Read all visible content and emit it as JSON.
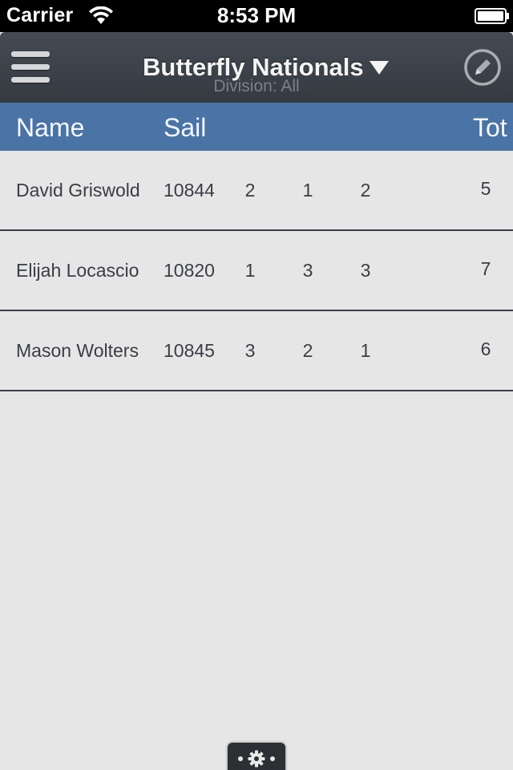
{
  "status_bar": {
    "carrier": "Carrier",
    "time": "8:53 PM"
  },
  "nav": {
    "title": "Butterfly Nationals",
    "subtitle": "Division: All",
    "menu_icon": "hamburger-menu-icon",
    "dropdown_icon": "triangle-down-icon",
    "edit_icon": "pencil-circle-icon"
  },
  "table": {
    "headers": {
      "name": "Name",
      "sail": "Sail",
      "total": "Tot"
    },
    "rows": [
      {
        "name": "David Griswold",
        "sail": "10844",
        "r1": "2",
        "r2": "1",
        "r3": "2",
        "total": "5"
      },
      {
        "name": "Elijah Locascio",
        "sail": "10820",
        "r1": "1",
        "r2": "3",
        "r3": "3",
        "total": "7"
      },
      {
        "name": "Mason Wolters",
        "sail": "10845",
        "r1": "3",
        "r2": "2",
        "r3": "1",
        "total": "6"
      }
    ]
  },
  "footer": {
    "settings_icon": "gear-icon"
  },
  "colors": {
    "nav_bg": "#3d4249",
    "header_bg": "#4a73a6",
    "body_bg": "#e6e6e6",
    "row_text": "#3a3d45"
  }
}
